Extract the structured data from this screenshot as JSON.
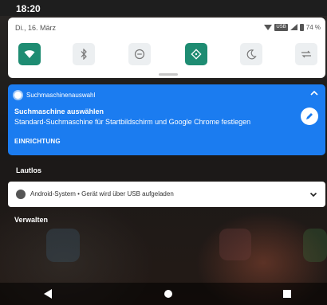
{
  "status_bar": {
    "time": "18:20"
  },
  "quick_settings": {
    "date": "Di., 16. März",
    "battery": "74 %",
    "tiles": [
      {
        "name": "wifi",
        "state": "on"
      },
      {
        "name": "bluetooth",
        "state": "off"
      },
      {
        "name": "do-not-disturb",
        "state": "off"
      },
      {
        "name": "auto-rotate",
        "state": "on"
      },
      {
        "name": "night-mode",
        "state": "off"
      },
      {
        "name": "sync",
        "state": "off"
      }
    ]
  },
  "notification_search": {
    "app_name": "Suchmaschinenauswahl",
    "title": "Suchmaschine auswählen",
    "text": "Standard-Suchmaschine für Startbildschirm und Google Chrome festlegen",
    "action": "EINRICHTUNG"
  },
  "section_silent": "Lautlos",
  "notification_system": {
    "text": "Android-System • Gerät wird über USB aufgeladen"
  },
  "section_manage": "Verwalten",
  "colors": {
    "accent_blue": "#1b7cf0",
    "tile_on": "#1e8c72"
  }
}
